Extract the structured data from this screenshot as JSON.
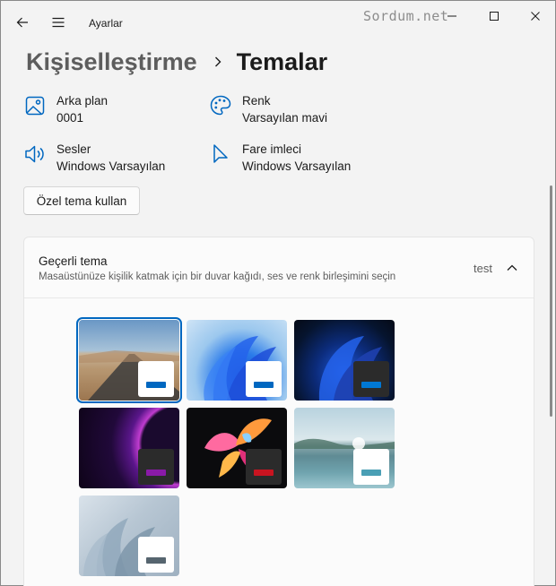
{
  "titlebar": {
    "app_title": "Ayarlar",
    "watermark": "Sordum.net"
  },
  "breadcrumb": {
    "parent": "Kişiselleştirme",
    "current": "Temalar"
  },
  "info_items": [
    {
      "label": "Arka plan",
      "value": "0001",
      "icon": "image-icon"
    },
    {
      "label": "Renk",
      "value": "Varsayılan mavi",
      "icon": "palette-icon"
    },
    {
      "label": "Sesler",
      "value": "Windows Varsayılan",
      "icon": "speaker-icon"
    },
    {
      "label": "Fare imleci",
      "value": "Windows Varsayılan",
      "icon": "cursor-icon"
    }
  ],
  "custom_button": "Özel tema kullan",
  "current_theme": {
    "title": "Geçerli tema",
    "subtitle": "Masaüstünüze kişilik katmak için bir duvar kağıdı, ses ve renk birleşimini seçin",
    "value": "test"
  },
  "themes": [
    {
      "name": "desert-road",
      "selected": true,
      "chip": "#ffffff",
      "bar": "#0067c0"
    },
    {
      "name": "windows-light-bloom",
      "selected": false,
      "chip": "#ffffff",
      "bar": "#0067c0"
    },
    {
      "name": "windows-dark-bloom",
      "selected": false,
      "chip": "#2b2b2b",
      "bar": "#0078d4"
    },
    {
      "name": "glow",
      "selected": false,
      "chip": "#2b2b2b",
      "bar": "#8a1aa8"
    },
    {
      "name": "captured-motion",
      "selected": false,
      "chip": "#2b2b2b",
      "bar": "#c81420"
    },
    {
      "name": "sunrise-lake",
      "selected": false,
      "chip": "#ffffff",
      "bar": "#4a9fb5"
    },
    {
      "name": "flow",
      "selected": false,
      "chip": "#ffffff",
      "bar": "#56656f"
    }
  ],
  "colors": {
    "accent": "#0067c0",
    "window_bg": "#f3f3f3",
    "card_bg": "#fbfbfb"
  }
}
